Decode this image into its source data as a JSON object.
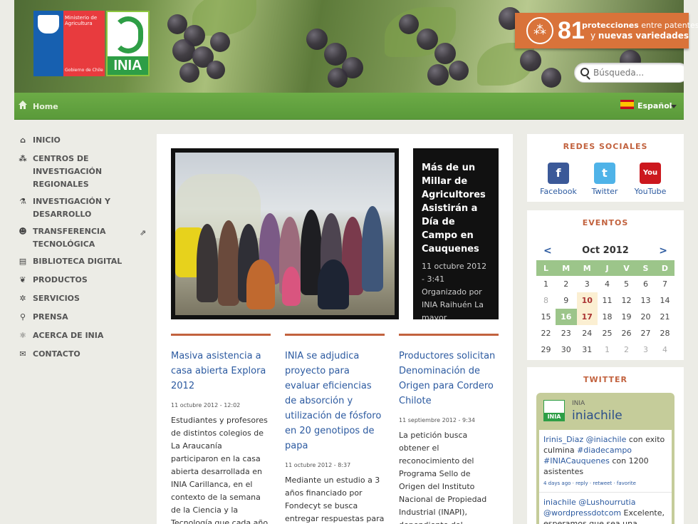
{
  "header": {
    "gov_logo_text": "Ministerio de Agricultura",
    "gov_logo_sub": "Gobierno de Chile",
    "inia_logo_text": "INIA",
    "banner": {
      "number": "81",
      "line1_bold": "protecciones",
      "line1_rest": " entre patentes",
      "line2_rest": "y ",
      "line2_bold": "nuevas variedades"
    },
    "search_placeholder": "Búsqueda..."
  },
  "navbar": {
    "home": "Home",
    "language": "Español"
  },
  "left_nav": [
    {
      "label": "INICIO",
      "icon": "home-icon"
    },
    {
      "label": "CENTROS DE INVESTIGACIÓN REGIONALES",
      "icon": "network-icon"
    },
    {
      "label": "INVESTIGACIÓN Y DESARROLLO",
      "icon": "flask-icon"
    },
    {
      "label": "TRANSFERENCIA TECNOLÓGICA",
      "icon": "people-icon",
      "external": true
    },
    {
      "label": "BIBLIOTECA DIGITAL",
      "icon": "book-icon"
    },
    {
      "label": "PRODUCTOS",
      "icon": "sprout-icon"
    },
    {
      "label": "SERVICIOS",
      "icon": "gears-icon"
    },
    {
      "label": "PRENSA",
      "icon": "microphone-icon"
    },
    {
      "label": "ACERCA DE INIA",
      "icon": "atom-icon"
    },
    {
      "label": "CONTACTO",
      "icon": "envelope-icon"
    }
  ],
  "feature": {
    "title": "Más de un Millar de Agricultores Asistirán a Día de Campo en Cauquenes",
    "date": "11 octubre 2012 - 3:41",
    "org": "Organizado por INIA Raihuén La mayor"
  },
  "articles": [
    {
      "title": "Masiva asistencia a casa abierta Explora 2012",
      "date": "11 octubre 2012 - 12:02",
      "body": "Estudiantes y profesores de distintos colegios de La Araucanía participaron en la casa abierta desarrollada en INIA Carillanca, en el contexto de la semana de la Ciencia y la Tecnología que cada año convoca"
    },
    {
      "title": "INIA se adjudica proyecto para evaluar eficiencias de absorción y utilización de fósforo en 20 genotipos de papa",
      "date": "11 octubre 2012 - 8:37",
      "body": "Mediante un estudio a 3 años financiado por Fondecyt se busca entregar respuestas para"
    },
    {
      "title": "Productores solicitan Denominación de Origen para Cordero Chilote",
      "date": "11 septiembre 2012 - 9:34",
      "body": "La petición busca obtener el reconocimiento del Programa Sello de Origen del Instituto Nacional de Propiedad Industrial (INAPI), dependiente del Ministerio de Economía"
    }
  ],
  "social": {
    "title": "REDES SOCIALES",
    "items": [
      {
        "label": "Facebook",
        "icon": "facebook-icon",
        "color": "#3b5998"
      },
      {
        "label": "Twitter",
        "icon": "twitter-icon",
        "color": "#4fb3e8"
      },
      {
        "label": "YouTube",
        "icon": "youtube-icon",
        "color": "#cc181e"
      }
    ]
  },
  "events": {
    "title": "EVENTOS",
    "prev": "<",
    "next": ">",
    "month": "Oct 2012",
    "weekdays": [
      "L",
      "M",
      "M",
      "J",
      "V",
      "S",
      "D"
    ],
    "weeks": [
      [
        "1",
        "2",
        "3",
        "4",
        "5",
        "6",
        "7"
      ],
      [
        "8",
        "9",
        "10",
        "11",
        "12",
        "13",
        "14"
      ],
      [
        "15",
        "16",
        "17",
        "18",
        "19",
        "20",
        "21"
      ],
      [
        "22",
        "23",
        "24",
        "25",
        "26",
        "27",
        "28"
      ],
      [
        "29",
        "30",
        "31",
        "1",
        "2",
        "3",
        "4"
      ]
    ],
    "event_days": [
      "10",
      "17"
    ],
    "today": "16"
  },
  "twitter": {
    "title": "TWITTER",
    "org": "INIA",
    "handle": "iniachile",
    "tweets": [
      {
        "user": "Irinis_Diaz",
        "mention": "@iniachile",
        "text1": " con exito culmina ",
        "tag1": "#diadecampo",
        "text2": " ",
        "tag2": "#INIACauquenes",
        "text3": " con 1200 asistentes",
        "meta": "4 days ago · reply · retweet · favorite"
      },
      {
        "user": "iniachile",
        "mention": "@Lushourrutia",
        "text1": " ",
        "tag1": "@wordpressdotcom",
        "text2": " Excelente, esperamos que sea una jornada",
        "tag2": "",
        "text3": "",
        "meta": ""
      }
    ]
  },
  "colors": {
    "accent": "#c2623e",
    "green_bar": "#5a9a3a",
    "link": "#2c5aa0",
    "banner": "#d9733a"
  }
}
